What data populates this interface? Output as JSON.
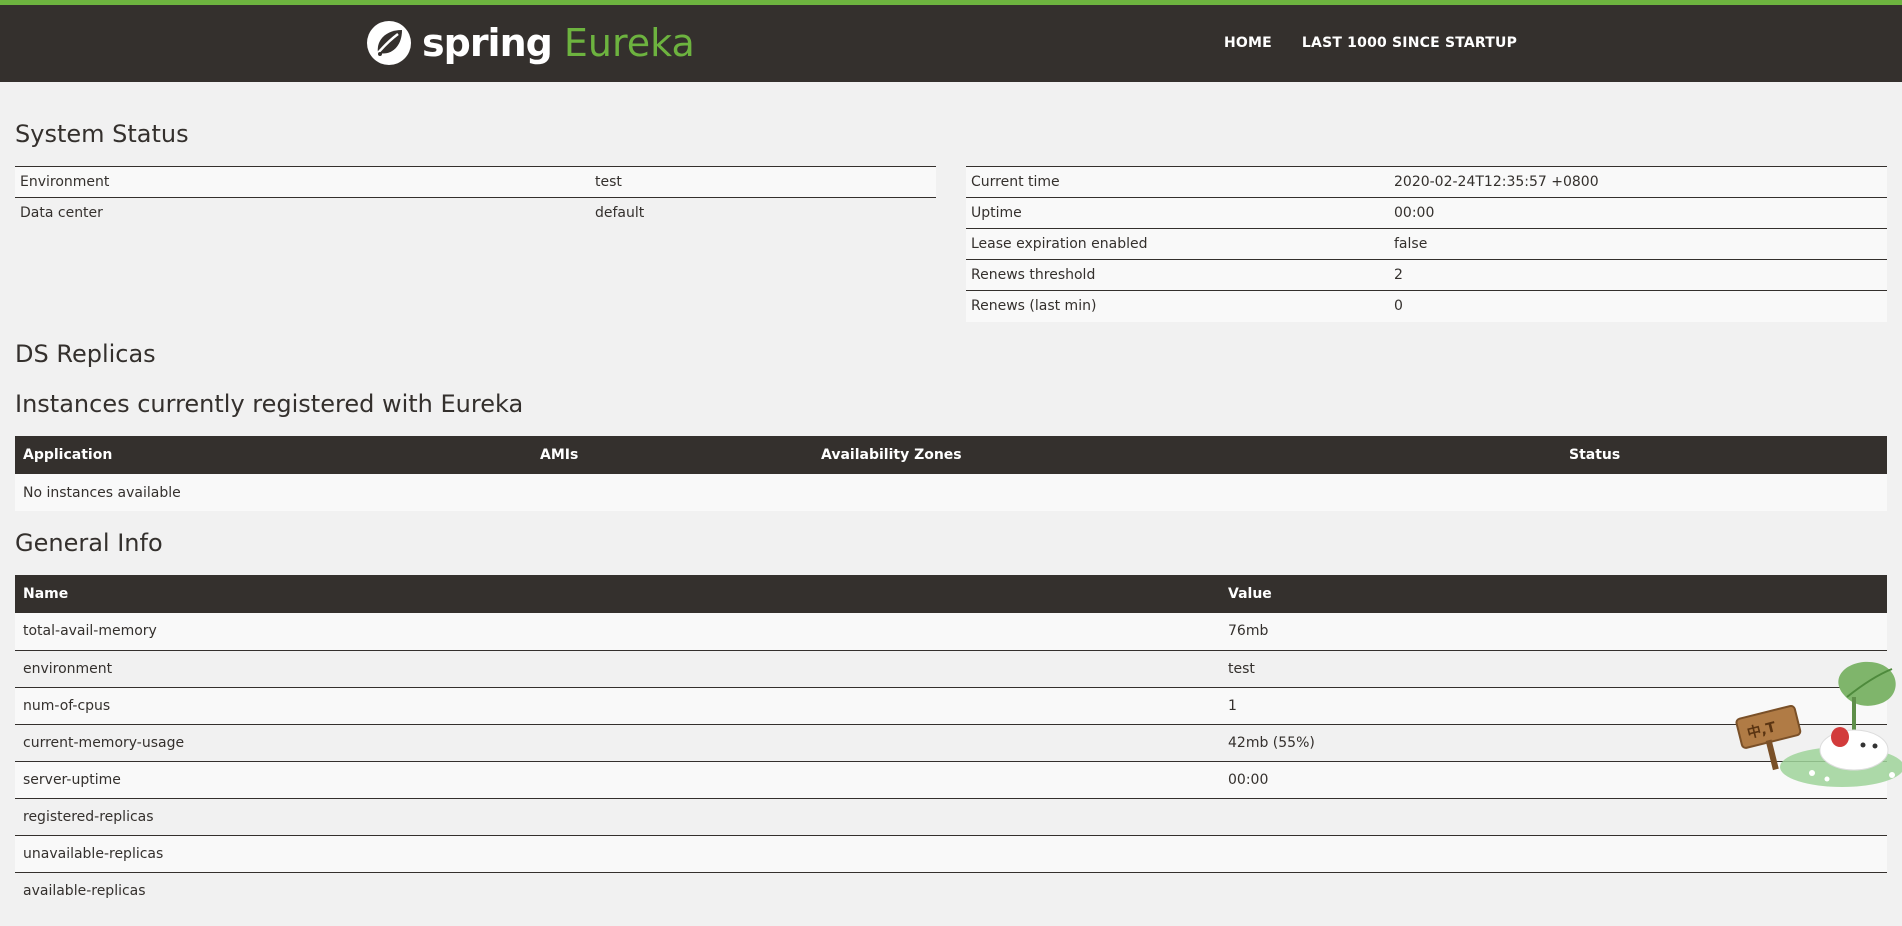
{
  "header": {
    "brand_spring": "spring",
    "brand_eureka": "Eureka",
    "nav": [
      {
        "label": "HOME"
      },
      {
        "label": "LAST 1000 SINCE STARTUP"
      }
    ]
  },
  "system_status": {
    "title": "System Status",
    "left": [
      {
        "name": "Environment",
        "value": "test"
      },
      {
        "name": "Data center",
        "value": "default"
      }
    ],
    "right": [
      {
        "name": "Current time",
        "value": "2020-02-24T12:35:57 +0800"
      },
      {
        "name": "Uptime",
        "value": "00:00"
      },
      {
        "name": "Lease expiration enabled",
        "value": "false"
      },
      {
        "name": "Renews threshold",
        "value": "2"
      },
      {
        "name": "Renews (last min)",
        "value": "0"
      }
    ]
  },
  "ds_replicas": {
    "title": "DS Replicas"
  },
  "instances": {
    "title": "Instances currently registered with Eureka",
    "columns": [
      "Application",
      "AMIs",
      "Availability Zones",
      "Status"
    ],
    "empty_text": "No instances available"
  },
  "general_info": {
    "title": "General Info",
    "columns": [
      "Name",
      "Value"
    ],
    "rows": [
      {
        "name": "total-avail-memory",
        "value": "76mb"
      },
      {
        "name": "environment",
        "value": "test"
      },
      {
        "name": "num-of-cpus",
        "value": "1"
      },
      {
        "name": "current-memory-usage",
        "value": "42mb (55%)"
      },
      {
        "name": "server-uptime",
        "value": "00:00"
      },
      {
        "name": "registered-replicas",
        "value": ""
      },
      {
        "name": "unavailable-replicas",
        "value": ""
      },
      {
        "name": "available-replicas",
        "value": ""
      }
    ]
  },
  "colors": {
    "brand_green": "#6db33f",
    "header_dark": "#34302d",
    "page_bg": "#f1f1f1"
  }
}
